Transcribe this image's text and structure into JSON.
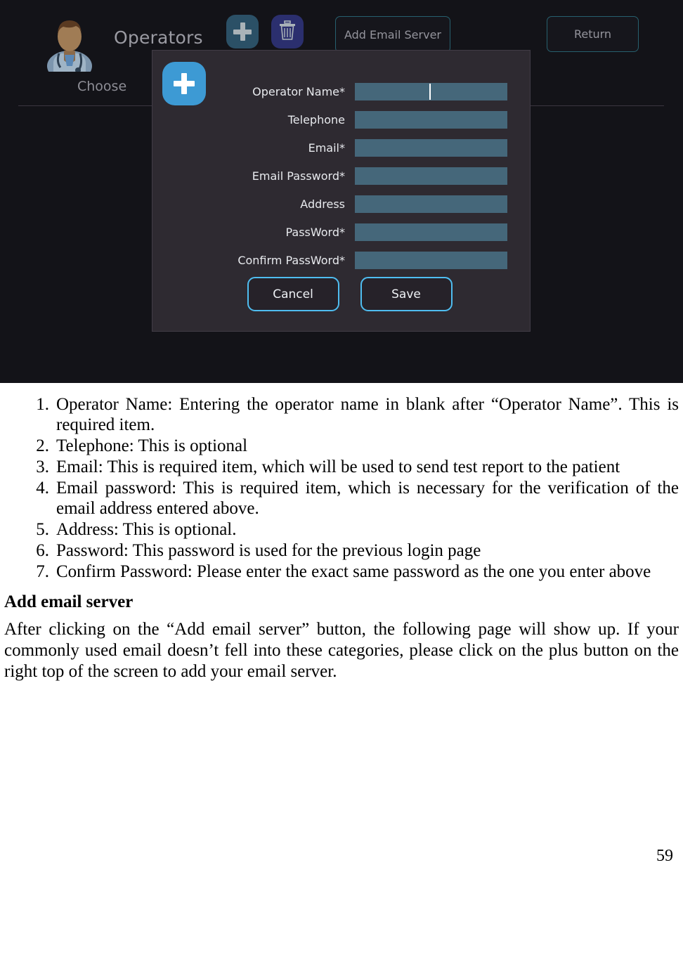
{
  "screenshot": {
    "header": {
      "avatar_icon": "doctor-avatar-icon",
      "title": "Operators",
      "choose_label": "Choose",
      "add_icon": "plus-icon",
      "delete_icon": "trash-icon",
      "add_email_server_label": "Add Email Server",
      "return_label": "Return"
    },
    "dialog": {
      "badge_icon": "plus-icon",
      "fields": [
        {
          "label": "Operator Name*",
          "value": "",
          "has_caret": true
        },
        {
          "label": "Telephone",
          "value": "",
          "has_caret": false
        },
        {
          "label": "Email*",
          "value": "",
          "has_caret": false
        },
        {
          "label": "Email Password*",
          "value": "",
          "has_caret": false
        },
        {
          "label": "Address",
          "value": "",
          "has_caret": false
        },
        {
          "label": "PassWord*",
          "value": "",
          "has_caret": false
        },
        {
          "label": "Confirm PassWord*",
          "value": "",
          "has_caret": false
        }
      ],
      "cancel_label": "Cancel",
      "save_label": "Save"
    },
    "colors": {
      "background": "#131318",
      "dialog_background": "#2e2a31",
      "input_fill": "#45677a",
      "accent_blue": "#3d9ad4",
      "button_border": "#4fbdf0",
      "outline_border": "#27606e",
      "add_icon_background": "#2b5066",
      "trash_icon_background": "#2b2f6e"
    }
  },
  "document": {
    "list": [
      {
        "num": "1.",
        "text": "Operator Name: Entering the operator name in blank after “Operator Name”. This is required item."
      },
      {
        "num": "2.",
        "text": "Telephone: This is optional"
      },
      {
        "num": "3.",
        "text": "Email: This is required item, which will be used to send test report to the patient"
      },
      {
        "num": "4.",
        "text": "Email password: This is required item, which is necessary for the verification of the email address entered above."
      },
      {
        "num": "5.",
        "text": "Address: This is optional."
      },
      {
        "num": "6.",
        "text": "Password: This password is used for the previous login page"
      },
      {
        "num": "7.",
        "text": "Confirm Password: Please enter the exact same password as the one you enter above"
      }
    ],
    "section_heading": "Add email server",
    "paragraph": "After clicking on the “Add email server” button, the following page will show up. If your commonly used email doesn’t fell into these categories, please click on the plus button on the right top of the screen to add your email server.",
    "page_number": "59"
  }
}
